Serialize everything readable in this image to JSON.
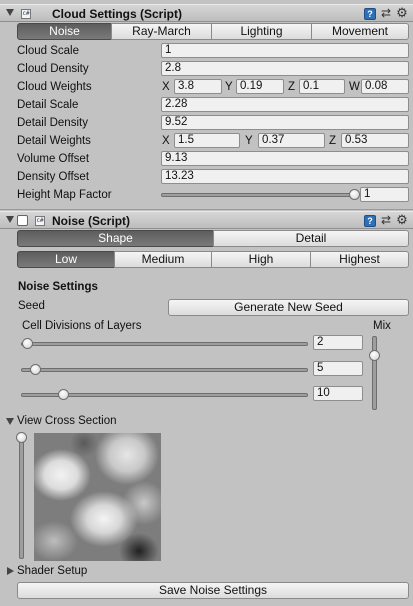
{
  "cloud_settings": {
    "title": "Cloud Settings (Script)",
    "tabs": [
      "Noise",
      "Ray-March",
      "Lighting",
      "Movement"
    ],
    "active_tab": "Noise",
    "fields": {
      "cloud_scale": {
        "label": "Cloud Scale",
        "value": "1"
      },
      "cloud_density": {
        "label": "Cloud Density",
        "value": "2.8"
      },
      "cloud_weights": {
        "label": "Cloud Weights",
        "x": "3.8",
        "y": "0.19",
        "z": "0.1",
        "w": "0.08"
      },
      "detail_scale": {
        "label": "Detail Scale",
        "value": "2.28"
      },
      "detail_density": {
        "label": "Detail Density",
        "value": "9.52"
      },
      "detail_weights": {
        "label": "Detail Weights",
        "x": "1.5",
        "y": "0.37",
        "z": "0.53"
      },
      "volume_offset": {
        "label": "Volume Offset",
        "value": "9.13"
      },
      "density_offset": {
        "label": "Density Offset",
        "value": "13.23"
      },
      "height_map_factor": {
        "label": "Height Map Factor",
        "value": "1",
        "slider_fraction": 1.0
      }
    },
    "axis_labels": {
      "x": "X",
      "y": "Y",
      "z": "Z",
      "w": "W"
    }
  },
  "noise": {
    "title": "Noise (Script)",
    "mode_tabs": [
      "Shape",
      "Detail"
    ],
    "active_mode": "Shape",
    "quality_tabs": [
      "Low",
      "Medium",
      "High",
      "Highest"
    ],
    "active_quality": "Low",
    "section_title": "Noise Settings",
    "seed_label": "Seed",
    "generate_seed_button": "Generate New Seed",
    "cell_divisions_label": "Cell Divisions of Layers",
    "mix_label": "Mix",
    "layers": [
      {
        "value": "2",
        "slider_fraction": 0.0
      },
      {
        "value": "5",
        "slider_fraction": 0.03
      },
      {
        "value": "10",
        "slider_fraction": 0.13
      }
    ],
    "mix_fraction": 0.25,
    "view_cross_section_label": "View Cross Section",
    "shader_setup_label": "Shader Setup",
    "save_button": "Save Noise Settings"
  },
  "icons": {
    "fold": "fold-arrow-icon",
    "script": "cs-script-icon",
    "help": "help-book-icon",
    "preset": "preset-sliders-icon",
    "settings": "gear-icon"
  },
  "colors": {
    "background": "#c2c2c2",
    "selected_tab": "#5d5d5d",
    "help_icon": "#2f6fb5"
  }
}
